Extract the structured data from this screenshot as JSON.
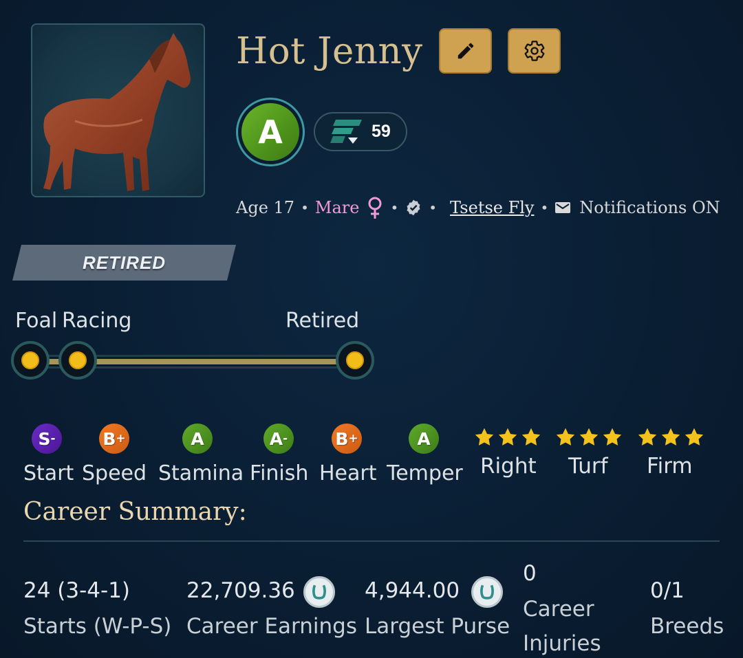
{
  "horse": {
    "name": "Hot Jenny",
    "grade": "A",
    "rating": "59",
    "age": "Age 17",
    "sex": "Mare",
    "owner": "Tsetse Fly",
    "notifications": "Notifications ON",
    "status": "RETIRED",
    "icons": [
      "edit-icon",
      "settings-gear-icon",
      "female-icon",
      "verified-icon",
      "mail-icon"
    ]
  },
  "lifecycle": {
    "stages": [
      "Foal",
      "Racing",
      "Retired"
    ],
    "progress": 1.0,
    "colors": {
      "track": "#a6955a",
      "node": "#f2bd1a"
    }
  },
  "attributes": [
    {
      "label": "Start",
      "grade": "S",
      "mod": "-",
      "color": "#5b22b0"
    },
    {
      "label": "Speed",
      "grade": "B",
      "mod": "+",
      "color": "#e06b1d"
    },
    {
      "label": "Stamina",
      "grade": "A",
      "mod": "",
      "color": "#4f951c"
    },
    {
      "label": "Finish",
      "grade": "A",
      "mod": "-",
      "color": "#4f951c"
    },
    {
      "label": "Heart",
      "grade": "B",
      "mod": "+",
      "color": "#e06b1d"
    },
    {
      "label": "Temper",
      "grade": "A",
      "mod": "",
      "color": "#4f951c"
    }
  ],
  "preferences": [
    {
      "label": "Right",
      "stars": 3
    },
    {
      "label": "Turf",
      "stars": 3
    },
    {
      "label": "Firm",
      "stars": 3
    }
  ],
  "career": {
    "title": "Career Summary:",
    "starts_value": "24 (3-4-1)",
    "starts_label": "Starts (W-P-S)",
    "earnings_value": "22,709.36",
    "earnings_label": "Career Earnings",
    "purse_value": "4,944.00",
    "purse_label": "Largest Purse",
    "injuries_value": "0",
    "injuries_label_1": "Career",
    "injuries_label_2": "Injuries",
    "breeds_value": "0/1",
    "breeds_label": "Breeds"
  },
  "colors": {
    "accent_gold": "#cfa252",
    "title_gold": "#d7c08f",
    "mare_pink": "#f29ad4",
    "background": "#0a1e33"
  }
}
